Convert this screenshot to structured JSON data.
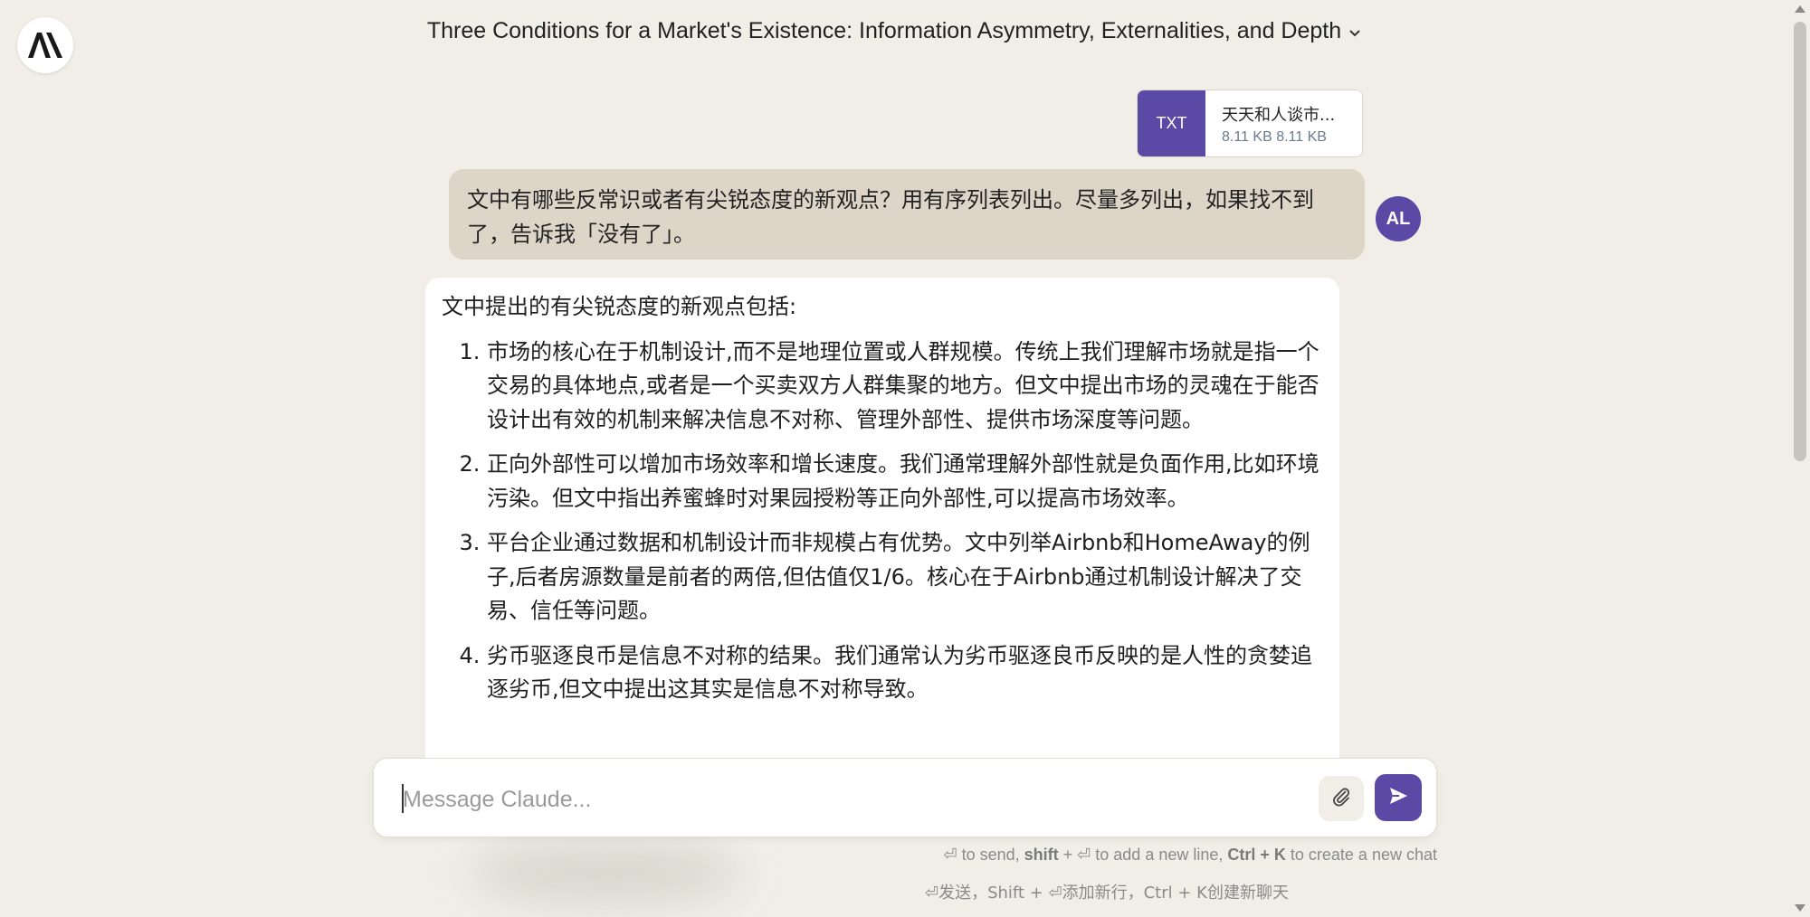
{
  "header": {
    "title": "Three Conditions for a Market's Existence: Information Asymmetry, Externalities, and Depth",
    "title_icon": "chevron-down-icon",
    "logo_icon": "anthropic-logo-icon"
  },
  "attachment": {
    "type": "TXT",
    "name": "天天和人谈市...",
    "size": "8.11 KB 8.11 KB"
  },
  "user_message": {
    "text": "文中有哪些反常识或者有尖锐态度的新观点？用有序列表列出。尽量多列出，如果找不到了，告诉我「没有了」。",
    "avatar": "AL"
  },
  "assistant_message": {
    "intro": "文中提出的有尖锐态度的新观点包括:",
    "items": [
      "市场的核心在于机制设计,而不是地理位置或人群规模。传统上我们理解市场就是指一个交易的具体地点,或者是一个买卖双方人群集聚的地方。但文中提出市场的灵魂在于能否设计出有效的机制来解决信息不对称、管理外部性、提供市场深度等问题。",
      "正向外部性可以增加市场效率和增长速度。我们通常理解外部性就是负面作用,比如环境污染。但文中指出养蜜蜂时对果园授粉等正向外部性,可以提高市场效率。",
      "平台企业通过数据和机制设计而非规模占有优势。文中列举Airbnb和HomeAway的例子,后者房源数量是前者的两倍,但估值仅1/6。核心在于Airbnb通过机制设计解决了交易、信任等问题。",
      "劣币驱逐良币是信息不对称的结果。我们通常认为劣币驱逐良币反映的是人性的贪婪追逐劣币,但文中提出这其实是信息不对称导致。"
    ]
  },
  "composer": {
    "placeholder": "Message Claude...",
    "value": "",
    "attach_icon": "paperclip-icon",
    "send_icon": "send-icon"
  },
  "hints": {
    "en_part1": "⏎ to send, ",
    "en_shift": "shift",
    "en_part2": " + ⏎ to add a new line, ",
    "en_ctrlk": "Ctrl + K",
    "en_part3": " to create a new chat",
    "zh": "⏎发送，Shift + ⏎添加新行，Ctrl + K创建新聊天"
  },
  "colors": {
    "background": "#f0eee6",
    "accent": "#5a4aa6",
    "user_bubble": "#ddd5c7",
    "assistant_bubble": "#ffffff"
  }
}
